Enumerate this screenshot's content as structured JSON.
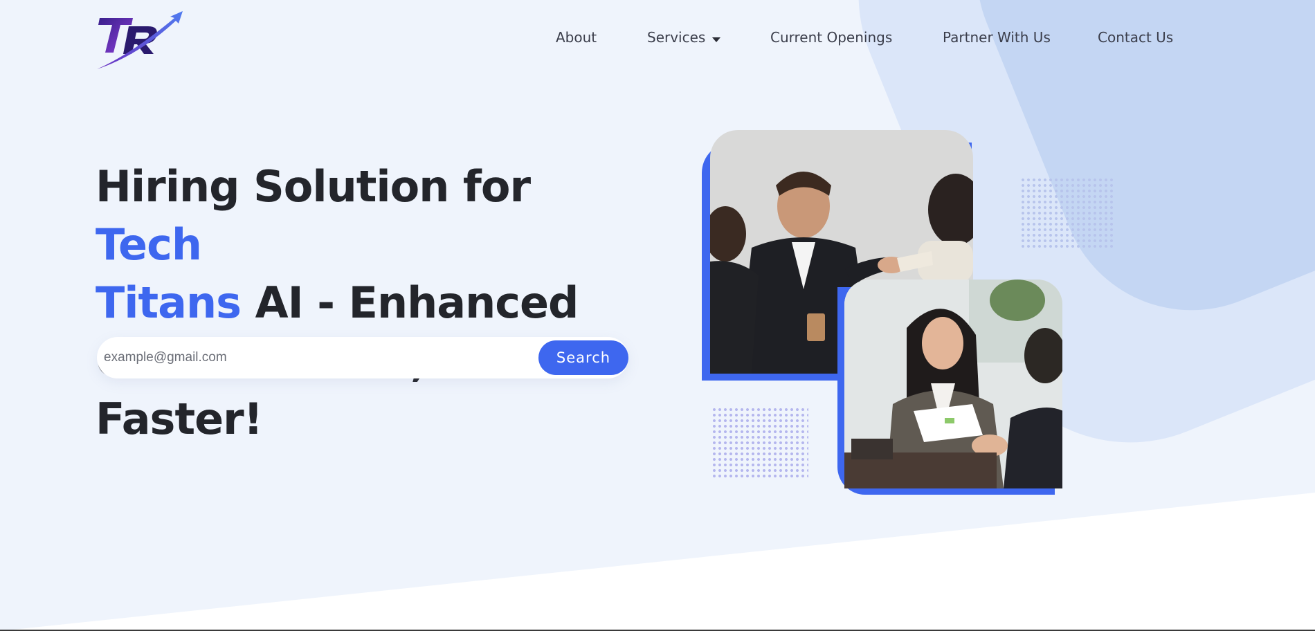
{
  "nav": {
    "about": "About",
    "services": "Services",
    "openings": "Current Openings",
    "partner": "Partner With Us",
    "contact": "Contact Us"
  },
  "hero": {
    "title_part1": "Hiring Solution for ",
    "title_accent1": "Tech",
    "title_accent2": "Titans",
    "title_part2": " AI - Enhanced",
    "title_part3": "Get Resource, 7X Faster!"
  },
  "search": {
    "placeholder": "example@gmail.com",
    "button_label": "Search"
  },
  "colors": {
    "accent": "#3e67ef",
    "heading": "#23252b",
    "background": "#eff4fc"
  }
}
